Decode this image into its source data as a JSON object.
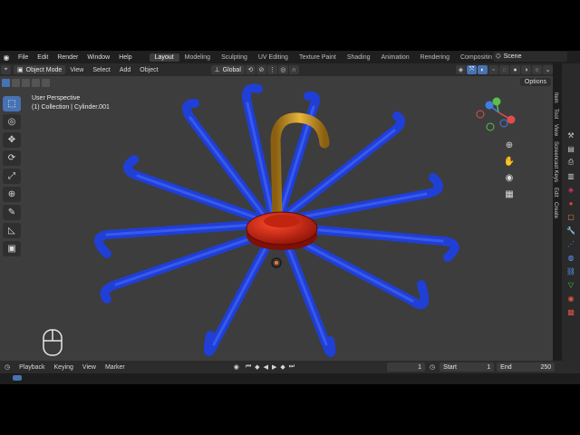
{
  "menubar": {
    "items": [
      "File",
      "Edit",
      "Render",
      "Window",
      "Help"
    ],
    "workspaces": [
      "Layout",
      "Modeling",
      "Sculpting",
      "UV Editing",
      "Texture Paint",
      "Shading",
      "Animation",
      "Rendering",
      "Compositin"
    ],
    "active_workspace": "Layout",
    "scene_name": "Scene"
  },
  "header": {
    "mode": "Object Mode",
    "menus": [
      "View",
      "Select",
      "Add",
      "Object"
    ],
    "orientation": "Global",
    "options_label": "Options"
  },
  "viewport": {
    "perspective_label": "User Perspective",
    "collection_label": "(1) Collection | Cylinder.001",
    "background": "#3d3d3d",
    "arm_color": "#1f3fd6",
    "hub_color": "#d12612",
    "handle_color": "#c8921e"
  },
  "n_panel_tabs": [
    "Item",
    "Tool",
    "View",
    "Screencast Keys",
    "Edit",
    "Create"
  ],
  "timeline": {
    "menus": [
      "Playback",
      "Keying",
      "View",
      "Marker"
    ],
    "current_frame": "1",
    "start_label": "Start",
    "start_value": "1",
    "end_label": "End",
    "end_value": "250"
  },
  "accent_color": "#4772b3"
}
